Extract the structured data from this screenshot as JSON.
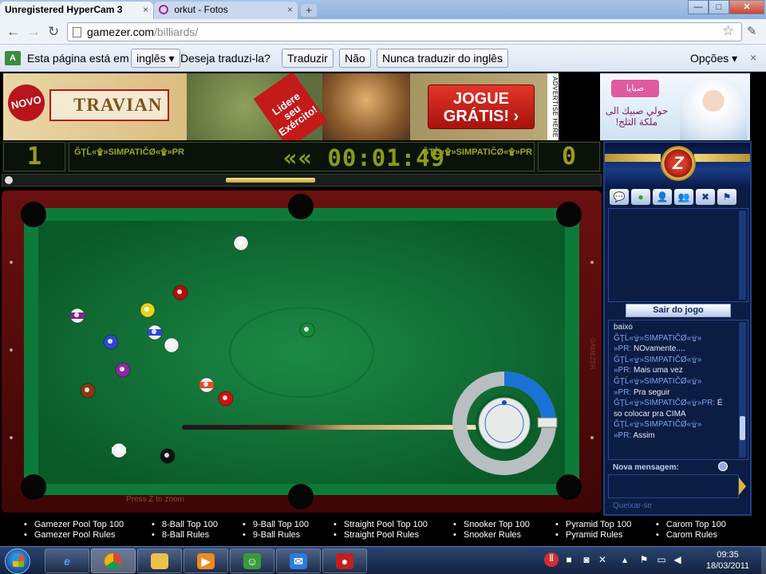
{
  "browser": {
    "tabs": [
      {
        "label": "Unregistered HyperCam 3",
        "close": "×"
      },
      {
        "label": "orkut - Fotos",
        "close": "×"
      }
    ],
    "new_tab": "+",
    "window_buttons": {
      "minimize": "—",
      "maximize": "□",
      "close": "✕"
    },
    "url_host": "gamezer.com",
    "url_path": "/billiards/",
    "translate_bar": {
      "icon": "translate-icon",
      "prefix": "Esta página está em",
      "language": "inglês",
      "question": "Deseja traduzi-la?",
      "translate_button": "Traduzir",
      "no_button": "Não",
      "never_button": "Nunca traduzir do inglês",
      "options": "Opções",
      "close": "×"
    }
  },
  "ads": {
    "travian": {
      "badge": "NOVO",
      "logo": "TRAVIAN",
      "slogan": "Lidere seu Exército!",
      "cta_line1": "JOGUE",
      "cta_line2": "GRÁTIS! ›"
    },
    "advertise_label": "ADVERTISE HERE",
    "side": {
      "brand": "صبايا",
      "text": "حولي صبيك الى ملكة الثلج!"
    }
  },
  "game": {
    "score_left": "1",
    "score_right": "0",
    "player_left": "ĞŢĹ«۩»SIMPATIČØ«۩»PR",
    "player_right": "ĞŢĹ«۩»SIMPATIČØ«۩»PR",
    "timer": "«« 00:01:49",
    "power": 0.5,
    "zoom_hint": "Press Z to zoom",
    "table_brand": "GAMEZER"
  },
  "panel": {
    "logo": "Z",
    "icons": [
      "chat-icon",
      "ball-icon",
      "user-icon",
      "users-icon",
      "tools-icon",
      "flag-icon"
    ],
    "leave_button": "Sair do jogo",
    "chat": [
      {
        "nick": "",
        "text": "baixo"
      },
      {
        "nick": "ĞŢĹ«۩»SIMPATIČØ«۩»",
        "text": ""
      },
      {
        "nick": "»PR:",
        "text": "NOvamente...."
      },
      {
        "nick": "ĞŢĹ«۩»SIMPATIČØ«۩»",
        "text": ""
      },
      {
        "nick": "»PR:",
        "text": "Mais uma vez"
      },
      {
        "nick": "ĞŢĹ«۩»SIMPATIČØ«۩»",
        "text": ""
      },
      {
        "nick": "»PR:",
        "text": "Pra seguir"
      },
      {
        "nick": "ĞŢĹ«۩»SIMPATIČØ«۩»PR:",
        "text": "É"
      },
      {
        "nick": "",
        "text": "so colocar pra CIMA"
      },
      {
        "nick": "ĞŢĹ«۩»SIMPATIČØ«۩»",
        "text": ""
      },
      {
        "nick": "»PR:",
        "text": "Assim"
      }
    ],
    "new_message_label": "Nova mensagem:",
    "report": "Queixar-se"
  },
  "links": [
    {
      "top": "Gamezer Pool Top 100",
      "rules": "Gamezer Pool Rules"
    },
    {
      "top": "8-Ball Top 100",
      "rules": "8-Ball Rules"
    },
    {
      "top": "9-Ball Top 100",
      "rules": "9-Ball Rules"
    },
    {
      "top": "Straight Pool Top 100",
      "rules": "Straight Pool Rules"
    },
    {
      "top": "Snooker Top 100",
      "rules": "Snooker Rules"
    },
    {
      "top": "Pyramid Top 100",
      "rules": "Pyramid Rules"
    },
    {
      "top": "Carom Top 100",
      "rules": "Carom Rules"
    }
  ],
  "taskbar": {
    "apps": [
      "ie-icon",
      "chrome-icon",
      "explorer-icon",
      "media-player-icon",
      "messenger-icon",
      "windows-live-icon",
      "hypercam-icon"
    ],
    "time": "09:35",
    "date": "18/03/2011"
  },
  "colors": {
    "felt": "#0b6a30",
    "rail": "#5a0c0c",
    "scoreboard_text": "#9a9a1e",
    "panel_bg": "#0c1d44"
  }
}
